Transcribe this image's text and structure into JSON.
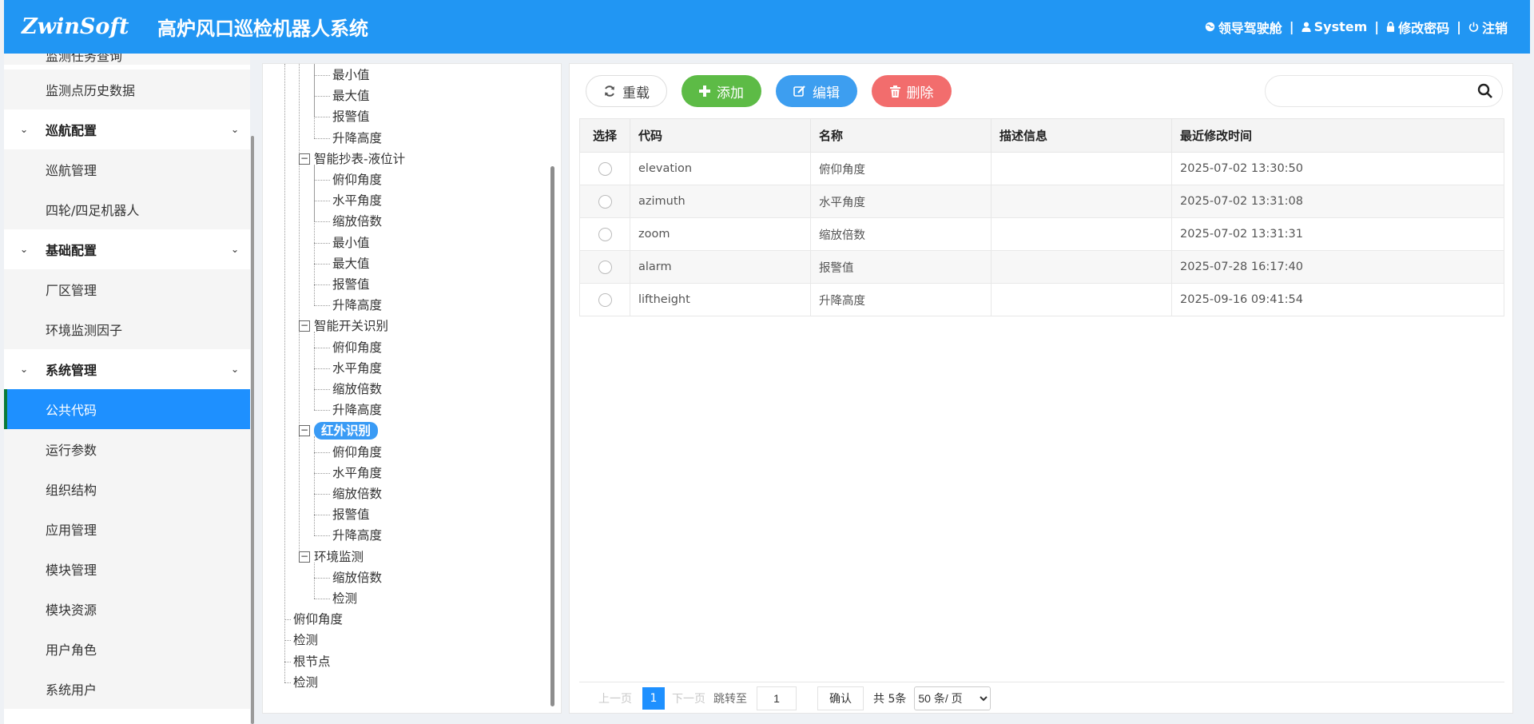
{
  "header": {
    "logo_text": "ZwinSoft",
    "title": "高炉风口巡检机器人系统",
    "nav": [
      "领导驾驶舱",
      "System",
      "修改密码",
      "注销"
    ]
  },
  "sidebar": {
    "items": [
      {
        "label": "监测任务查询",
        "type": "child"
      },
      {
        "label": "监测点历史数据",
        "type": "child"
      },
      {
        "label": "巡航配置",
        "type": "group"
      },
      {
        "label": "巡航管理",
        "type": "child"
      },
      {
        "label": "四轮/四足机器人",
        "type": "child"
      },
      {
        "label": "基础配置",
        "type": "group"
      },
      {
        "label": "厂区管理",
        "type": "child"
      },
      {
        "label": "环境监测因子",
        "type": "child"
      },
      {
        "label": "系统管理",
        "type": "group"
      },
      {
        "label": "公共代码",
        "type": "active"
      },
      {
        "label": "运行参数",
        "type": "child"
      },
      {
        "label": "组织结构",
        "type": "child"
      },
      {
        "label": "应用管理",
        "type": "child"
      },
      {
        "label": "模块管理",
        "type": "child"
      },
      {
        "label": "模块资源",
        "type": "child"
      },
      {
        "label": "用户角色",
        "type": "child"
      },
      {
        "label": "系统用户",
        "type": "child"
      }
    ]
  },
  "tree": {
    "nodes": [
      {
        "label": "最小值",
        "level": 2
      },
      {
        "label": "最大值",
        "level": 2
      },
      {
        "label": "报警值",
        "level": 2
      },
      {
        "label": "升降高度",
        "level": 2
      },
      {
        "label": "智能抄表-液位计",
        "level": 1,
        "toggle": "−"
      },
      {
        "label": "俯仰角度",
        "level": 2
      },
      {
        "label": "水平角度",
        "level": 2
      },
      {
        "label": "缩放倍数",
        "level": 2
      },
      {
        "label": "最小值",
        "level": 2
      },
      {
        "label": "最大值",
        "level": 2
      },
      {
        "label": "报警值",
        "level": 2
      },
      {
        "label": "升降高度",
        "level": 2
      },
      {
        "label": "智能开关识别",
        "level": 1,
        "toggle": "−"
      },
      {
        "label": "俯仰角度",
        "level": 2
      },
      {
        "label": "水平角度",
        "level": 2
      },
      {
        "label": "缩放倍数",
        "level": 2
      },
      {
        "label": "升降高度",
        "level": 2
      },
      {
        "label": "红外识别",
        "level": 1,
        "toggle": "−",
        "selected": true
      },
      {
        "label": "俯仰角度",
        "level": 2
      },
      {
        "label": "水平角度",
        "level": 2
      },
      {
        "label": "缩放倍数",
        "level": 2
      },
      {
        "label": "报警值",
        "level": 2
      },
      {
        "label": "升降高度",
        "level": 2
      },
      {
        "label": "环境监测",
        "level": 1,
        "toggle": "−"
      },
      {
        "label": "缩放倍数",
        "level": 2
      },
      {
        "label": "检测",
        "level": 2
      },
      {
        "label": "俯仰角度",
        "level": 0
      },
      {
        "label": "检测",
        "level": 0
      },
      {
        "label": "根节点",
        "level": 0
      },
      {
        "label": "检测",
        "level": 0
      }
    ]
  },
  "toolbar": {
    "reload_label": "重载",
    "add_label": "添加",
    "edit_label": "编辑",
    "delete_label": "删除",
    "search_value": ""
  },
  "table": {
    "columns": [
      "选择",
      "代码",
      "名称",
      "描述信息",
      "最近修改时间"
    ],
    "rows": [
      {
        "code": "elevation",
        "name": "俯仰角度",
        "desc": "",
        "modified": "2025-07-02 13:30:50"
      },
      {
        "code": "azimuth",
        "name": "水平角度",
        "desc": "",
        "modified": "2025-07-02 13:31:08"
      },
      {
        "code": "zoom",
        "name": "缩放倍数",
        "desc": "",
        "modified": "2025-07-02 13:31:31"
      },
      {
        "code": "alarm",
        "name": "报警值",
        "desc": "",
        "modified": "2025-07-28 16:17:40"
      },
      {
        "code": "liftheight",
        "name": "升降高度",
        "desc": "",
        "modified": "2025-09-16 09:41:54"
      }
    ]
  },
  "pager": {
    "prev": "上一页",
    "current": "1",
    "next": "下一页",
    "jump_label": "跳转至",
    "jump_value": "1",
    "confirm": "确认",
    "total": "共 5条",
    "page_size": "50 条/ 页"
  },
  "colors": {
    "header_bg": "#2196f3",
    "active_menu": "#1e90ff",
    "add": "#5dbb46",
    "edit": "#3d9ef0",
    "delete": "#f26d6d"
  }
}
